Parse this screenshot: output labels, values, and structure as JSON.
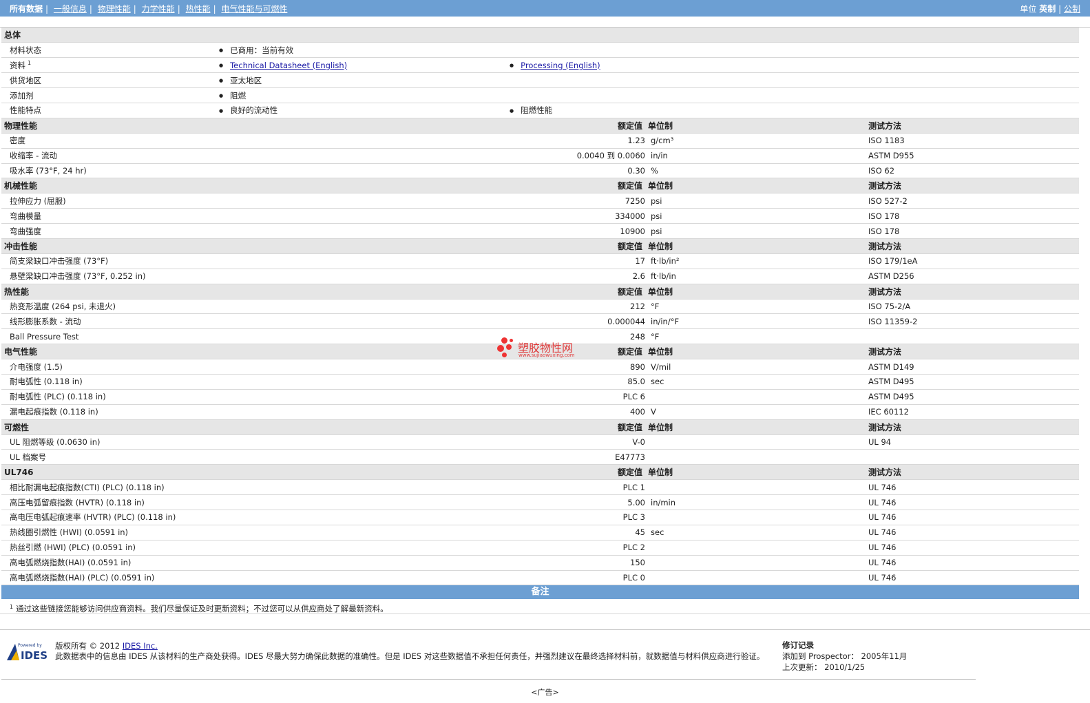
{
  "topbar": {
    "tabs": [
      "所有数据",
      "一般信息",
      "物理性能",
      "力学性能",
      "热性能",
      "电气性能与可燃性"
    ],
    "units_label": "单位",
    "unit_imperial": "英制",
    "unit_metric": "公制"
  },
  "general": {
    "title": "总体",
    "rows": [
      {
        "label": "材料状态",
        "c1": "已商用：当前有效",
        "c2": ""
      },
      {
        "label": "资料",
        "sup": "1",
        "c1": "Technical Datasheet (English)",
        "c2": "Processing (English)",
        "links": true
      },
      {
        "label": "供货地区",
        "c1": "亚太地区",
        "c2": ""
      },
      {
        "label": "添加剂",
        "c1": "阻燃",
        "c2": ""
      },
      {
        "label": "性能特点",
        "c1": "良好的流动性",
        "c2": "阻燃性能"
      }
    ]
  },
  "col_headers": {
    "value": "额定值",
    "unit": "单位制",
    "method": "测试方法"
  },
  "sections": [
    {
      "title": "物理性能",
      "rows": [
        {
          "name": "密度",
          "value": "1.23",
          "unit": "g/cm³",
          "method": "ISO 1183"
        },
        {
          "name": "收缩率 - 流动",
          "value": "0.0040 到  0.0060",
          "unit": "in/in",
          "method": "ASTM D955"
        },
        {
          "name": "吸水率 (73°F, 24 hr)",
          "value": "0.30",
          "unit": "%",
          "method": "ISO 62"
        }
      ]
    },
    {
      "title": "机械性能",
      "rows": [
        {
          "name": "拉伸应力 (屈服)",
          "value": "7250",
          "unit": "psi",
          "method": "ISO 527-2"
        },
        {
          "name": "弯曲模量",
          "value": "334000",
          "unit": "psi",
          "method": "ISO 178"
        },
        {
          "name": "弯曲强度",
          "value": "10900",
          "unit": "psi",
          "method": "ISO 178"
        }
      ]
    },
    {
      "title": "冲击性能",
      "rows": [
        {
          "name": "简支梁缺口冲击强度 (73°F)",
          "value": "17",
          "unit": "ft·lb/in²",
          "method": "ISO 179/1eA"
        },
        {
          "name": "悬壁梁缺口冲击强度 (73°F, 0.252 in)",
          "value": "2.6",
          "unit": "ft·lb/in",
          "method": "ASTM D256"
        }
      ]
    },
    {
      "title": "热性能",
      "rows": [
        {
          "name": "热变形温度 (264 psi, 未退火)",
          "value": "212",
          "unit": "°F",
          "method": "ISO 75-2/A"
        },
        {
          "name": "线形膨胀系数 - 流动",
          "value": "0.000044",
          "unit": "in/in/°F",
          "method": "ISO 11359-2"
        },
        {
          "name": "Ball Pressure Test",
          "value": "248",
          "unit": "°F",
          "method": ""
        }
      ]
    },
    {
      "title": "电气性能",
      "rows": [
        {
          "name": "介电强度 (1.5)",
          "value": "890",
          "unit": "V/mil",
          "method": "ASTM D149"
        },
        {
          "name": "耐电弧性 (0.118 in)",
          "value": "85.0",
          "unit": "sec",
          "method": "ASTM D495"
        },
        {
          "name": "耐电弧性 (PLC) (0.118 in)",
          "value": "PLC 6",
          "unit": "",
          "method": "ASTM D495"
        },
        {
          "name": "漏电起痕指数 (0.118 in)",
          "value": "400",
          "unit": "V",
          "method": "IEC 60112"
        }
      ]
    },
    {
      "title": "可燃性",
      "rows": [
        {
          "name": "UL 阻燃等级 (0.0630 in)",
          "value": "V-0",
          "unit": "",
          "method": "UL 94"
        },
        {
          "name": "UL 档案号",
          "value": "E47773",
          "unit": "",
          "method": ""
        }
      ]
    },
    {
      "title": "UL746",
      "rows": [
        {
          "name": "相比耐漏电起痕指数(CTI) (PLC) (0.118 in)",
          "value": "PLC 1",
          "unit": "",
          "method": "UL 746"
        },
        {
          "name": "高压电弧留痕指数 (HVTR) (0.118 in)",
          "value": "5.00",
          "unit": "in/min",
          "method": "UL 746"
        },
        {
          "name": "高电压电弧起痕速率 (HVTR) (PLC) (0.118 in)",
          "value": "PLC 3",
          "unit": "",
          "method": "UL 746"
        },
        {
          "name": "热线圈引燃性 (HWI) (0.0591 in)",
          "value": "45",
          "unit": "sec",
          "method": "UL 746"
        },
        {
          "name": "热丝引燃 (HWI) (PLC) (0.0591 in)",
          "value": "PLC 2",
          "unit": "",
          "method": "UL 746"
        },
        {
          "name": "高电弧燃烧指数(HAI) (0.0591 in)",
          "value": "150",
          "unit": "",
          "method": "UL 746"
        },
        {
          "name": "高电弧燃烧指数(HAI) (PLC) (0.0591 in)",
          "value": "PLC 0",
          "unit": "",
          "method": "UL 746"
        }
      ]
    }
  ],
  "notes": {
    "title": "备注",
    "sup": "1",
    "text": "通过这些链接您能够访问供应商资料。我们尽量保证及时更新资料；不过您可以从供应商处了解最新资料。"
  },
  "footer": {
    "logo_small": "Powered by",
    "logo_text": "IDES",
    "copyright_prefix": "版权所有 © 2012 ",
    "copyright_link": "IDES Inc.",
    "disclaimer": "此数据表中的信息由 IDES 从该材料的生产商处获得。IDES 尽最大努力确保此数据的准确性。但是 IDES 对这些数据值不承担任何责任，并强烈建议在最终选择材料前，就数据值与材料供应商进行验证。",
    "revisions_title": "修订记录",
    "added_label": "添加到 Prospector：",
    "added_value": "2005年11月",
    "updated_label": "上次更新：",
    "updated_value": "2010/1/25",
    "ad": "<广告>"
  },
  "watermark": {
    "text": "塑胶物性网",
    "url": "www.sujiaowuxing.com"
  }
}
